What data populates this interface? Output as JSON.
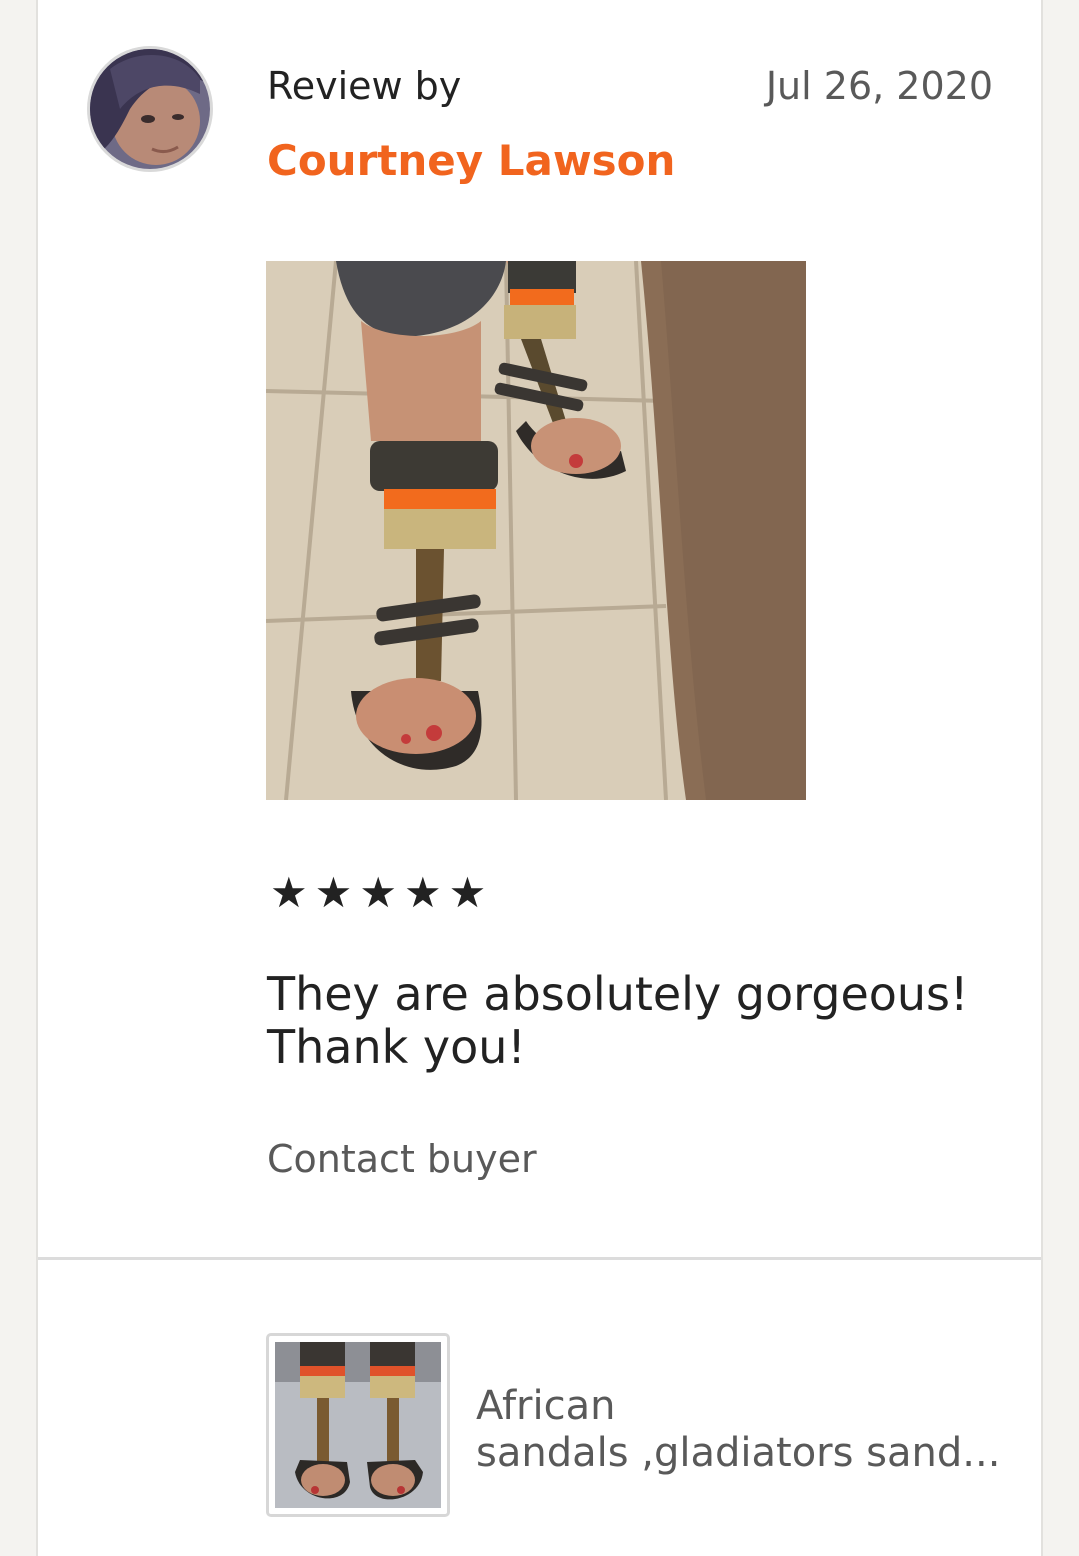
{
  "review": {
    "header_label": "Review by",
    "reviewer_name": "Courtney Lawson",
    "date": "Jul 26, 2020",
    "rating": 5,
    "stars": [
      "★",
      "★",
      "★",
      "★",
      "★"
    ],
    "text_line1": "They are absolutely gorgeous!",
    "text_line2": "Thank you!",
    "contact_label": "Contact buyer"
  },
  "listing": {
    "title_line1": "African",
    "title_line2": "sandals ,gladiators sand..."
  },
  "colors": {
    "accent": "#f1641e",
    "text": "#222222",
    "muted": "#595959"
  }
}
